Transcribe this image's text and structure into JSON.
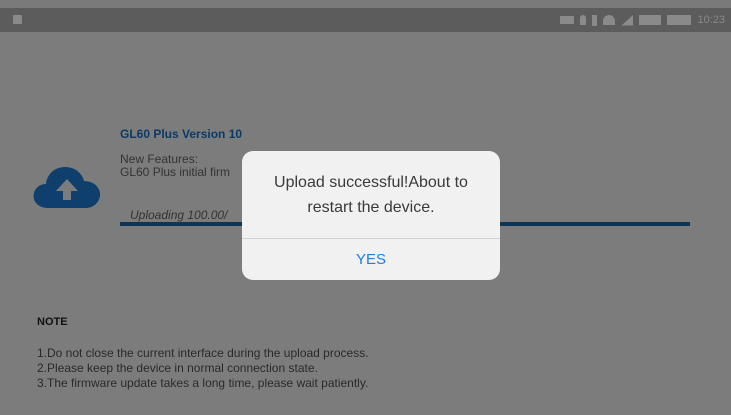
{
  "status_bar": {
    "time": "10:23",
    "icons": [
      "gallery-icon",
      "device-icon",
      "location-icon",
      "bluetooth-icon",
      "wifi-icon",
      "signal-icon",
      "sim-icon",
      "battery-icon"
    ]
  },
  "firmware": {
    "title": "GL60 Plus Version 10",
    "features_label": "New Features:",
    "features_text": "GL60 Plus initial firm",
    "uploading_text": "Uploading  100.00/",
    "progress": 1.0
  },
  "note": {
    "title": "NOTE",
    "lines": [
      "1.Do not close the current interface during the upload process.",
      "2.Please keep the device in normal connection state.",
      "3.The firmware update takes a long time, please wait patiently."
    ]
  },
  "dialog": {
    "message": "Upload successful!About to restart the device.",
    "confirm_label": "YES"
  },
  "colors": {
    "overlay": "#7a7a7a",
    "accent": "#1a7fe6",
    "progress": "#0d3558"
  }
}
